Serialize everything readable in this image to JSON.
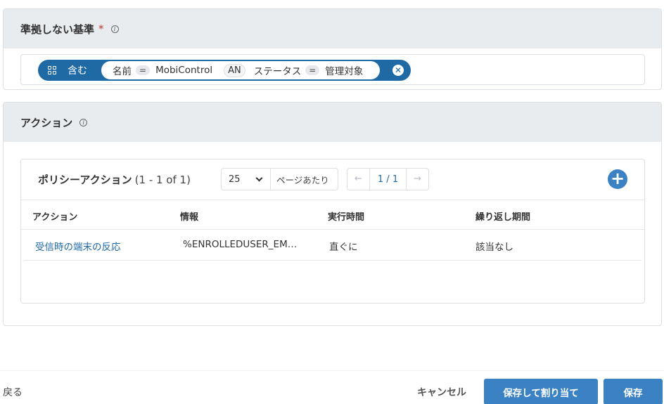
{
  "criteria": {
    "title": "準拠しない基準",
    "required_mark": "*",
    "filter": {
      "operator_label": "含む",
      "field1": "名前",
      "eq1": "=",
      "value1": "MobiControl",
      "conjunction": "AN",
      "field2": "ステータス",
      "eq2": "=",
      "value2": "管理対象"
    }
  },
  "actions": {
    "title": "アクション",
    "table": {
      "title": "ポリシーアクション",
      "count": "(1 - 1 of 1)",
      "page_size": "25",
      "page_size_label": "ページあたり",
      "pager": {
        "prev": "←",
        "current": "1 / 1",
        "next": "→"
      },
      "add": "+",
      "columns": [
        "アクション",
        "情報",
        "実行時間",
        "繰り返し期間"
      ],
      "rows": [
        [
          "受信時の端末の反応",
          "%ENROLLEDUSER_EM…",
          "直ぐに",
          "該当なし"
        ]
      ]
    }
  },
  "footer": {
    "back": "戻る",
    "cancel": "キャンセル",
    "save_assign": "保存して割り当て",
    "save": "保存"
  },
  "colors": {
    "accent": "#3b82c4",
    "pill": "#1f6aa5",
    "header_bg": "#e9ecef",
    "required": "#c0392b"
  }
}
